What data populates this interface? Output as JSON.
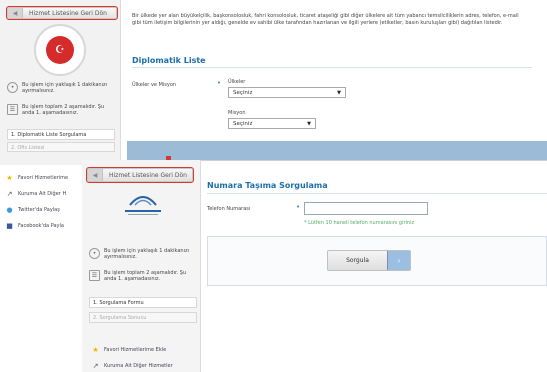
{
  "back_window": {
    "back_button_label": "Hizmet Listesine Geri Dön",
    "info_steps": "Bu işlem için yaklaşık 1 dakikanızı ayırmalısınız.",
    "info_pages": "Bu işlem toplam 2 aşamalıdır. Şu anda 1. aşamadasınız.",
    "steps": [
      "1. Diplomatik Liste Sorgulama",
      "2. Ofis Listesi"
    ],
    "description": "Bir ülkede yer alan büyükelçilik, başkonsolosluk, fahri konsolosluk, ticaret ataşeliği gibi diğer ülkelere ait tüm yabancı temsilciliklerin adres, telefon, e-mail gibi tüm iletişim bilgilerinin yer aldığı, genelde ev sahibi ülke tarafından hazırlanan ve ilgili yerlere (etiketler, basın kuruluşları gibi) dağıtılan listedir.",
    "section_title": "Diplomatik Liste",
    "countries_label": "Ülkeler ve Misyon",
    "countries_field_label": "Ülkeler",
    "countries_value": "Seçiniz",
    "mission_field_label": "Misyon",
    "mission_value": "Seçiniz",
    "links": [
      "Favori Hizmetlerime",
      "Kuruma Ait Diğer H",
      "Twitter'da Paylaş",
      "Facebook'da Payla"
    ]
  },
  "front_window": {
    "back_button_label": "Hizmet Listesine Geri Dön",
    "info_steps": "Bu işlem için yaklaşık 1 dakikanızı ayırmalısınız.",
    "info_pages": "Bu işlem toplam 2 aşamalıdır. Şu anda 1. aşamadasınız.",
    "steps": [
      "1. Sorgulama Formu",
      "2. Sorgulama Sonucu"
    ],
    "page_title": "Numara Taşıma Sorgulama",
    "phone_label": "Telefon Numarası",
    "phone_value": "",
    "hint": "* Lütfen 10 haneli telefon numarasını giriniz",
    "submit_label": "Sorgula",
    "links": [
      "Favori Hizmetlerime Ekle",
      "Kuruma Ait Diğer Hizmetler"
    ]
  },
  "icons": [
    "chevron-left-icon",
    "info-icon",
    "pages-icon",
    "star-icon",
    "link-icon",
    "twitter-icon",
    "facebook-icon",
    "chevron-down-icon",
    "arrow-right-icon"
  ],
  "colors": {
    "accent": "#1c6fab",
    "highlight": "#d9372e",
    "hint": "#55aa66"
  }
}
